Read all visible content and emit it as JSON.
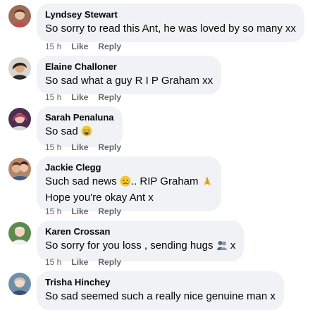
{
  "comments": [
    {
      "author": "Lyndsey Stewart",
      "text": "So sorry to read this Ant, he was loved by so many xx",
      "time": "15 h",
      "like": "Like",
      "reply": "Reply"
    },
    {
      "author": "Elaine Challoner",
      "text": "So sad what a guy R I P Graham xx",
      "time": "15 h",
      "like": "Like",
      "reply": "Reply"
    },
    {
      "author": "Sarah Penaluna",
      "text": "So sad",
      "emoji": "crying-face",
      "time": "15 h",
      "like": "Like",
      "reply": "Reply"
    },
    {
      "author": "Jackie Clegg",
      "text_a": "Such sad news",
      "emoji_a": "sad-face",
      "text_b": ".. RIP Graham",
      "emoji_b": "folded-hands",
      "line2": "Hope you're okay Ant x",
      "time": "15 h",
      "like": "Like",
      "reply": "Reply"
    },
    {
      "author": "Karen Crossan",
      "text_a": "So sorry for you loss , sending hugs",
      "emoji_a": "people-hugging",
      "text_b": "x",
      "time": "15 h",
      "like": "Like",
      "reply": "Reply"
    },
    {
      "author": "Trisha Hinchey",
      "text": "So sad seemed such a really nice genuine man x"
    }
  ]
}
